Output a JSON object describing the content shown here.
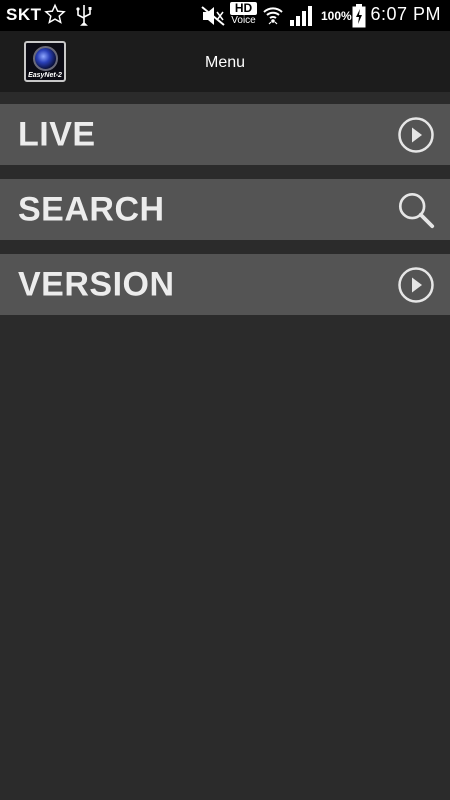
{
  "status_bar": {
    "carrier": "SKT",
    "hd_label": "HD",
    "voice_label": "Voice",
    "battery_percent": "100%",
    "time": "6:07 PM"
  },
  "app_bar": {
    "logo_text": "EasyNet-2",
    "title": "Menu"
  },
  "menu": {
    "items": [
      {
        "label": "LIVE",
        "icon": "play-circle-icon"
      },
      {
        "label": "SEARCH",
        "icon": "search-icon"
      },
      {
        "label": "VERSION",
        "icon": "play-circle-icon"
      }
    ]
  },
  "colors": {
    "background": "#2b2b2b",
    "app_bar": "#1c1c1c",
    "menu_item": "#545454",
    "text": "#ececec"
  }
}
